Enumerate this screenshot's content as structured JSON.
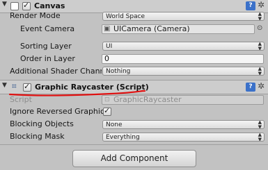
{
  "canvas": {
    "title": "Canvas",
    "enabled": true,
    "render_mode_label": "Render Mode",
    "render_mode_value": "World Space",
    "event_camera_label": "Event Camera",
    "event_camera_value": "UICamera (Camera)",
    "sorting_layer_label": "Sorting Layer",
    "sorting_layer_value": "UI",
    "order_in_layer_label": "Order in Layer",
    "order_in_layer_value": "0",
    "shader_channels_label": "Additional Shader Chann",
    "shader_channels_value": "Nothing"
  },
  "raycaster": {
    "title": "Graphic Raycaster (Script)",
    "enabled": true,
    "script_label": "Script",
    "script_value": "GraphicRaycaster",
    "ignore_reversed_label": "Ignore Reversed Graphic",
    "ignore_reversed_checked": true,
    "blocking_objects_label": "Blocking Objects",
    "blocking_objects_value": "None",
    "blocking_mask_label": "Blocking Mask",
    "blocking_mask_value": "Everything"
  },
  "footer": {
    "add_component_label": "Add Component"
  },
  "colors": {
    "annotation": "#e01010",
    "help_button": "#3b71c9"
  },
  "icons": {
    "help": "help-icon",
    "gear": "gear-icon",
    "checkmark": "checkmark-icon",
    "script": "script-icon",
    "camera": "camera-icon",
    "dropdown": "dropdown-arrows-icon"
  }
}
